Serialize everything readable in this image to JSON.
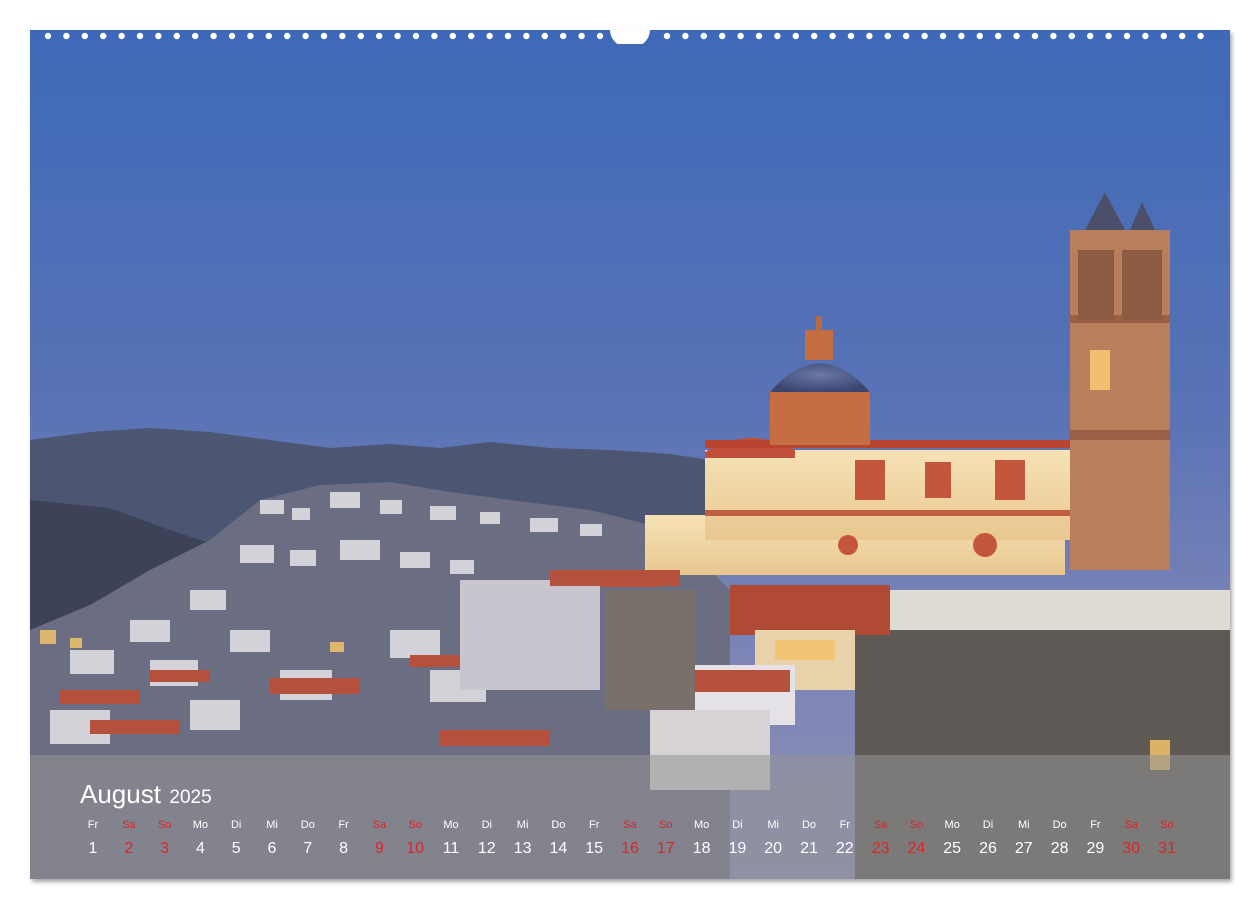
{
  "calendar": {
    "month": "August",
    "year": "2025",
    "weekend_color": "#d9262a",
    "text_color": "#ffffff",
    "days": [
      {
        "abbr": "Fr",
        "num": "1",
        "weekend": false
      },
      {
        "abbr": "Sa",
        "num": "2",
        "weekend": true
      },
      {
        "abbr": "So",
        "num": "3",
        "weekend": true
      },
      {
        "abbr": "Mo",
        "num": "4",
        "weekend": false
      },
      {
        "abbr": "Di",
        "num": "5",
        "weekend": false
      },
      {
        "abbr": "Mi",
        "num": "6",
        "weekend": false
      },
      {
        "abbr": "Do",
        "num": "7",
        "weekend": false
      },
      {
        "abbr": "Fr",
        "num": "8",
        "weekend": false
      },
      {
        "abbr": "Sa",
        "num": "9",
        "weekend": true
      },
      {
        "abbr": "So",
        "num": "10",
        "weekend": true
      },
      {
        "abbr": "Mo",
        "num": "11",
        "weekend": false
      },
      {
        "abbr": "Di",
        "num": "12",
        "weekend": false
      },
      {
        "abbr": "Mi",
        "num": "13",
        "weekend": false
      },
      {
        "abbr": "Do",
        "num": "14",
        "weekend": false
      },
      {
        "abbr": "Fr",
        "num": "15",
        "weekend": false
      },
      {
        "abbr": "Sa",
        "num": "16",
        "weekend": true
      },
      {
        "abbr": "So",
        "num": "17",
        "weekend": true
      },
      {
        "abbr": "Mo",
        "num": "18",
        "weekend": false
      },
      {
        "abbr": "Di",
        "num": "19",
        "weekend": false
      },
      {
        "abbr": "Mi",
        "num": "20",
        "weekend": false
      },
      {
        "abbr": "Do",
        "num": "21",
        "weekend": false
      },
      {
        "abbr": "Fr",
        "num": "22",
        "weekend": false
      },
      {
        "abbr": "Sa",
        "num": "23",
        "weekend": true
      },
      {
        "abbr": "So",
        "num": "24",
        "weekend": true
      },
      {
        "abbr": "Mo",
        "num": "25",
        "weekend": false
      },
      {
        "abbr": "Di",
        "num": "26",
        "weekend": false
      },
      {
        "abbr": "Mi",
        "num": "27",
        "weekend": false
      },
      {
        "abbr": "Do",
        "num": "28",
        "weekend": false
      },
      {
        "abbr": "Fr",
        "num": "29",
        "weekend": false
      },
      {
        "abbr": "Sa",
        "num": "30",
        "weekend": true
      },
      {
        "abbr": "So",
        "num": "31",
        "weekend": true
      }
    ]
  },
  "photo": {
    "sky_top_color": "#3d69b8",
    "sky_horizon_color": "#7f86b6",
    "church_color": "#f3dcae",
    "roof_color": "#b5503c"
  }
}
